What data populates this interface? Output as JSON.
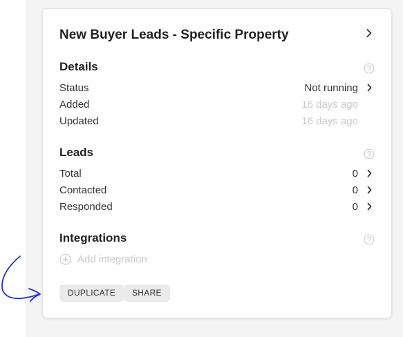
{
  "card": {
    "title": "New Buyer Leads - Specific Property"
  },
  "details": {
    "header": "Details",
    "rows": [
      {
        "label": "Status",
        "value": "Not running"
      },
      {
        "label": "Added",
        "value": "16 days ago"
      },
      {
        "label": "Updated",
        "value": "16 days ago"
      }
    ]
  },
  "leads": {
    "header": "Leads",
    "rows": [
      {
        "label": "Total",
        "value": "0"
      },
      {
        "label": "Contacted",
        "value": "0"
      },
      {
        "label": "Responded",
        "value": "0"
      }
    ]
  },
  "integrations": {
    "header": "Integrations",
    "add_label": "Add integration"
  },
  "actions": {
    "duplicate_label": "DUPLICATE",
    "share_label": "SHARE"
  },
  "colors": {
    "annotation_arrow": "#1f2fd6",
    "muted_text": "#c9c9c9"
  },
  "icons": [
    "chevron-right-icon",
    "help-circle-icon",
    "plus-circle-icon",
    "hand-drawn-arrow"
  ]
}
